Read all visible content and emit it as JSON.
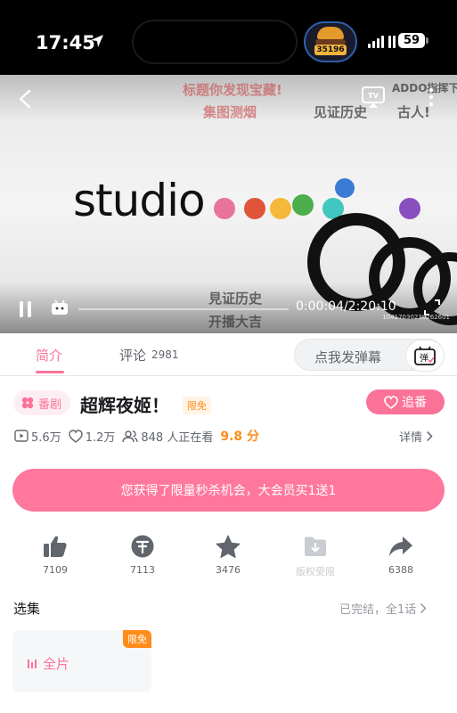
{
  "status_bar": {
    "time": "17:45",
    "badge_count": "35196",
    "battery": "59"
  },
  "video": {
    "danmaku": [
      "标题你发现宝藏!",
      "集图测烟",
      "见证历史",
      "古人!",
      "見证历史",
      "开播大吉",
      "ADDO指挥下"
    ],
    "logo_text": "studio",
    "time_display": "0:00:04/2:20:10",
    "watermark": "10417030230262601"
  },
  "tabs": {
    "intro": "简介",
    "comments": "评论",
    "comment_count": "2981",
    "danmu_placeholder": "点我发弹幕",
    "danmu_button": "弹"
  },
  "show": {
    "category": "番剧",
    "title": "超辉夜姬！",
    "free_tag": "限免",
    "follow_label": "追番",
    "plays": "5.6万",
    "likes_count": "1.2万",
    "watching": "848 人正在看",
    "score": "9.8 分",
    "detail_label": "详情"
  },
  "promo": {
    "text": "您获得了限量秒杀机会，大会员买1送1"
  },
  "actions": [
    {
      "name": "like",
      "count": "7109"
    },
    {
      "name": "coin",
      "count": "7113"
    },
    {
      "name": "favorite",
      "count": "3476"
    },
    {
      "name": "download",
      "count": "版权受限"
    },
    {
      "name": "share",
      "count": "6388"
    }
  ],
  "episodes": {
    "label": "选集",
    "status": "已完结，全1话",
    "card_tag": "限免",
    "card_name": "全片"
  },
  "colors": {
    "accent": "#fb7299",
    "orange": "#ff8c1a",
    "promo": "#ff779d"
  }
}
